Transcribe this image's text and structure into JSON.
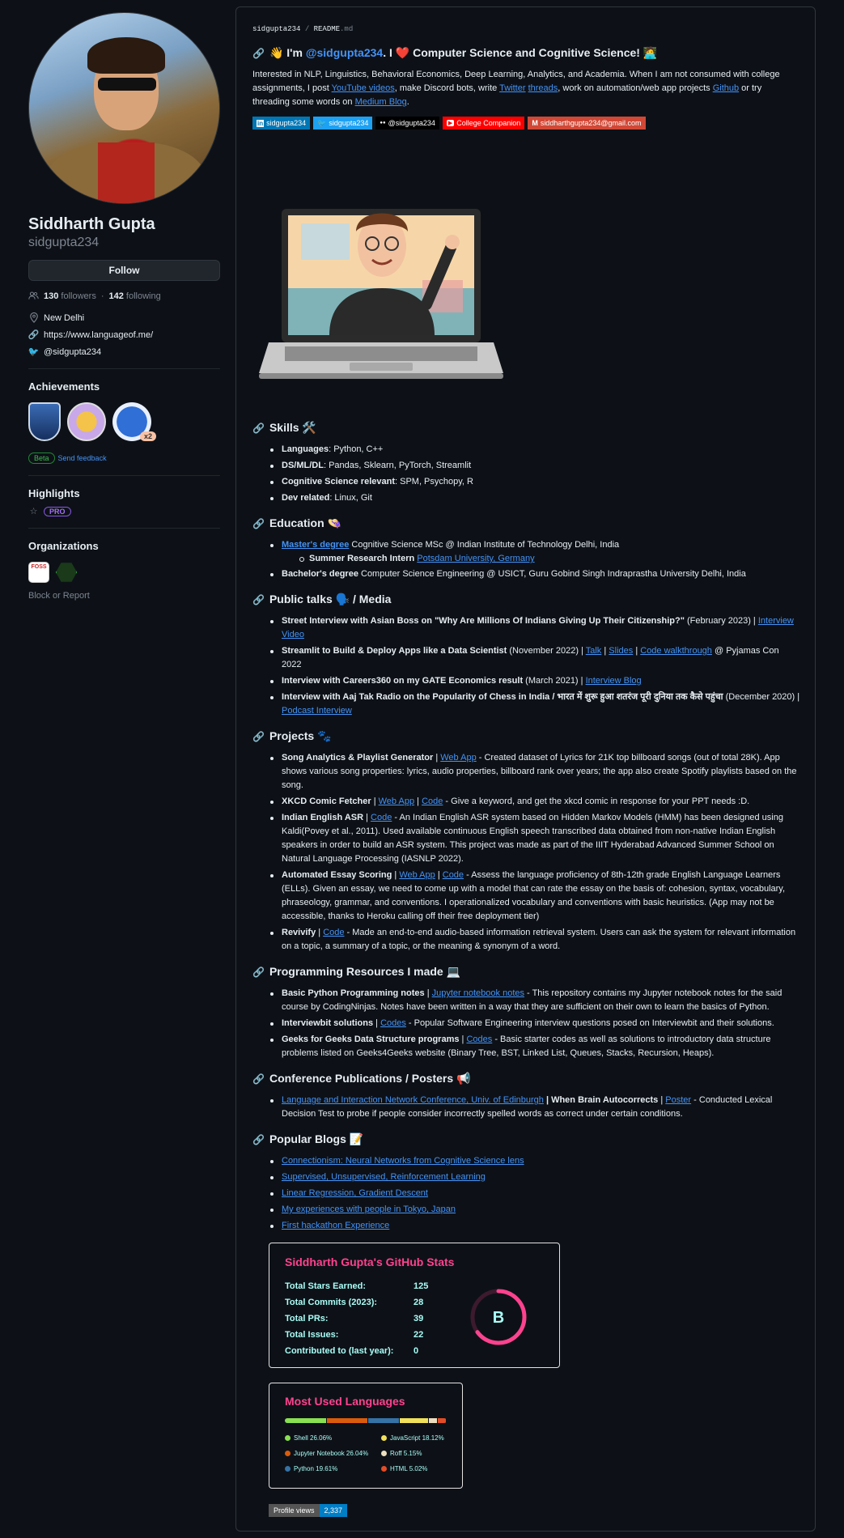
{
  "profile": {
    "name": "Siddharth Gupta",
    "login": "sidgupta234",
    "follow_label": "Follow",
    "followers": "130",
    "followers_label": "followers",
    "following": "142",
    "following_label": "following",
    "location": "New Delhi",
    "website": "https://www.languageof.me/",
    "twitter": "@sidgupta234",
    "achievements_title": "Achievements",
    "achievement_count": "x2",
    "beta_label": "Beta",
    "feedback_label": "Send feedback",
    "highlights_title": "Highlights",
    "pro_label": "PRO",
    "organizations_title": "Organizations",
    "org1_text": "FOSS",
    "block_label": "Block or Report"
  },
  "readme": {
    "crumb_user": "sidgupta234",
    "crumb_sep": " / ",
    "crumb_file": "README",
    "crumb_ext": ".md",
    "heading_pre": "👋 I'm ",
    "heading_handle": "@sidgupta234",
    "heading_mid": ". I ",
    "heading_heart": "❤️",
    "heading_post": " Computer Science and Cognitive Science! 🧑‍💻",
    "intro_1": "Interested in NLP, Linguistics, Behavioral Economics, Deep Learning, Analytics, and Academia. When I am not consumed with college assignments, I post ",
    "intro_yt": "YouTube videos",
    "intro_2": ", make Discord bots, write ",
    "intro_tw": "Twitter",
    "intro_3": " ",
    "intro_th": "threads",
    "intro_4": ", work on automation/web app projects ",
    "intro_gh": "Github",
    "intro_5": " or try threading some words on ",
    "intro_mb": "Medium Blog",
    "intro_6": ".",
    "shields": [
      {
        "label": "sidgupta234",
        "color": "#0077b5",
        "icon": "in"
      },
      {
        "label": "sidgupta234",
        "color": "#1da1f2",
        "icon": "🐦"
      },
      {
        "label": "@sidgupta234",
        "color": "#000000",
        "icon": "●●"
      },
      {
        "label": "College Companion",
        "color": "#ff0000",
        "icon": "▶"
      },
      {
        "label": "siddharthgupta234@gmail.com",
        "color": "#d14836",
        "icon": "M"
      }
    ]
  },
  "skills": {
    "title": "Skills 🛠️",
    "items": [
      {
        "k": "Languages",
        "v": ": Python, C++"
      },
      {
        "k": "DS/ML/DL",
        "v": ": Pandas, Sklearn, PyTorch, Streamlit"
      },
      {
        "k": "Cognitive Science relevant",
        "v": ": SPM, Psychopy, R"
      },
      {
        "k": "Dev related",
        "v": ":   Linux, Git"
      }
    ]
  },
  "education": {
    "title": "Education 👒",
    "masters_link": "Master's degree",
    "masters_text": " Cognitive Science MSc @ Indian Institute of Technology Delhi, India",
    "intern_bold": "Summer Research Intern",
    "intern_link": "Potsdam University, Germany",
    "bachelor_bold": "Bachelor's degree",
    "bachelor_text": " Computer Science Engineering @ USICT, Guru Gobind Singh Indraprastha University Delhi, India"
  },
  "talks": {
    "title": "Public talks 🗣️ / Media",
    "t1_bold": "Street Interview with Asian Boss on \"Why Are Millions Of Indians Giving Up Their Citizenship?\"",
    "t1_text": " (February 2023) | ",
    "t1_link": "Interview Video",
    "t2_bold": "Streamlit to Build & Deploy Apps like a Data Scientist",
    "t2_text": " (November 2022) | ",
    "t2_l1": "Talk",
    "t2_l2": "Slides",
    "t2_l3": "Code walkthrough",
    "t2_end": " @ Pyjamas Con 2022",
    "t3_bold": "Interview with Careers360 on my GATE Economics result",
    "t3_text": " (March 2021) | ",
    "t3_link": "Interview Blog",
    "t4_bold": "Interview with Aaj Tak Radio on the Popularity of Chess in India / भारत में शुरू हुआ शतरंज पूरी दुनिया तक कैसे पहुंचा",
    "t4_text": " (December 2020) | ",
    "t4_link": "Podcast Interview"
  },
  "projects": {
    "title": "Projects 🐾",
    "p1_bold": "Song Analytics & Playlist Generator",
    "p1_link": "Web App",
    "p1_text": " - Created dataset of Lyrics for 21K top billboard songs (out of total 28K). App shows various song properties: lyrics, audio properties, billboard rank over years; the app also create Spotify playlists based on the song.",
    "p2_bold": "XKCD Comic Fetcher",
    "p2_l1": "Web App",
    "p2_l2": "Code",
    "p2_text": " - Give a keyword, and get the xkcd comic in response for your PPT needs :D.",
    "p3_bold": "Indian English ASR",
    "p3_link": "Code",
    "p3_text": " - An Indian English ASR system based on Hidden Markov Models (HMM) has been designed using Kaldi(Povey et al., 2011). Used available continuous English speech transcribed data obtained from non-native Indian English speakers in order to build an ASR system. This project was made as part of the IIIT Hyderabad Advanced Summer School on Natural Language Processing (IASNLP 2022).",
    "p4_bold": "Automated Essay Scoring",
    "p4_l1": "Web App",
    "p4_l2": "Code",
    "p4_text": " - Assess the language proficiency of 8th-12th grade English Language Learners (ELLs). Given an essay, we need to come up with a model that can rate the essay on the basis of: cohesion, syntax, vocabulary, phraseology, grammar, and conventions. I operationalized vocabulary and conventions with basic heuristics. (App may not be accessible, thanks to Heroku calling off their free deployment tier)",
    "p5_bold": "Revivify",
    "p5_link": "Code",
    "p5_text": " - Made an end-to-end audio-based information retrieval system. Users can ask the system for relevant information on a topic, a summary of a topic, or the meaning & synonym of a word."
  },
  "resources": {
    "title": "Programming Resources I made 💻",
    "r1_bold": "Basic Python Programming notes",
    "r1_link": "Jupyter notebook notes",
    "r1_text": " - This repository contains my Jupyter notebook notes for the said course by CodingNinjas. Notes have been written in a way that they are sufficient on their own to learn the basics of Python.",
    "r2_bold": "Interviewbit solutions",
    "r2_link": "Codes",
    "r2_text": " - Popular Software Engineering interview questions posed on Interviewbit and their solutions.",
    "r3_bold": "Geeks for Geeks Data Structure programs",
    "r3_link": "Codes",
    "r3_text": " - Basic starter codes as well as solutions to introductory data structure problems listed on Geeks4Geeks website (Binary Tree, BST, Linked List, Queues, Stacks, Recursion, Heaps)."
  },
  "pubs": {
    "title": "Conference Publications / Posters 📢",
    "c1_link": "Language and Interaction Network Conference, Univ. of Edinburgh",
    "c1_bold": " | When Brain Autocorrects",
    "c1_l2": "Poster",
    "c1_text": " - Conducted Lexical Decision Test to probe if people consider incorrectly spelled words as correct under certain conditions."
  },
  "blogs": {
    "title": "Popular Blogs 📝",
    "items": [
      "Connectionism: Neural Networks from Cognitive Science lens",
      "Supervised, Unsupervised, Reinforcement Learning",
      "Linear Regression, Gradient Descent",
      "My experiences with people in Tokyo, Japan",
      "First hackathon Experience"
    ]
  },
  "stats": {
    "title": "Siddharth Gupta's GitHub Stats",
    "rows": [
      {
        "k": "Total Stars Earned:",
        "v": "125"
      },
      {
        "k": "Total Commits (2023):",
        "v": "28"
      },
      {
        "k": "Total PRs:",
        "v": "39"
      },
      {
        "k": "Total Issues:",
        "v": "22"
      },
      {
        "k": "Contributed to (last year):",
        "v": "0"
      }
    ],
    "grade": "B",
    "ring_fraction": 0.65,
    "accent": "#fe428e",
    "text_color": "#a9fef7"
  },
  "langs": {
    "title": "Most Used Languages",
    "items": [
      {
        "name": "Shell",
        "pct": 26.06,
        "label": "Shell 26.06%",
        "color": "#89e051"
      },
      {
        "name": "Jupyter Notebook",
        "pct": 26.04,
        "label": "Jupyter Notebook 26.04%",
        "color": "#da5b0b"
      },
      {
        "name": "Python",
        "pct": 19.61,
        "label": "Python 19.61%",
        "color": "#3572a5"
      },
      {
        "name": "JavaScript",
        "pct": 18.12,
        "label": "JavaScript 18.12%",
        "color": "#f1e05a"
      },
      {
        "name": "Roff",
        "pct": 5.15,
        "label": "Roff 5.15%",
        "color": "#ecdebe"
      },
      {
        "name": "HTML",
        "pct": 5.02,
        "label": "HTML 5.02%",
        "color": "#e34c26"
      }
    ]
  },
  "views": {
    "label": "Profile views",
    "count": "2,337"
  }
}
